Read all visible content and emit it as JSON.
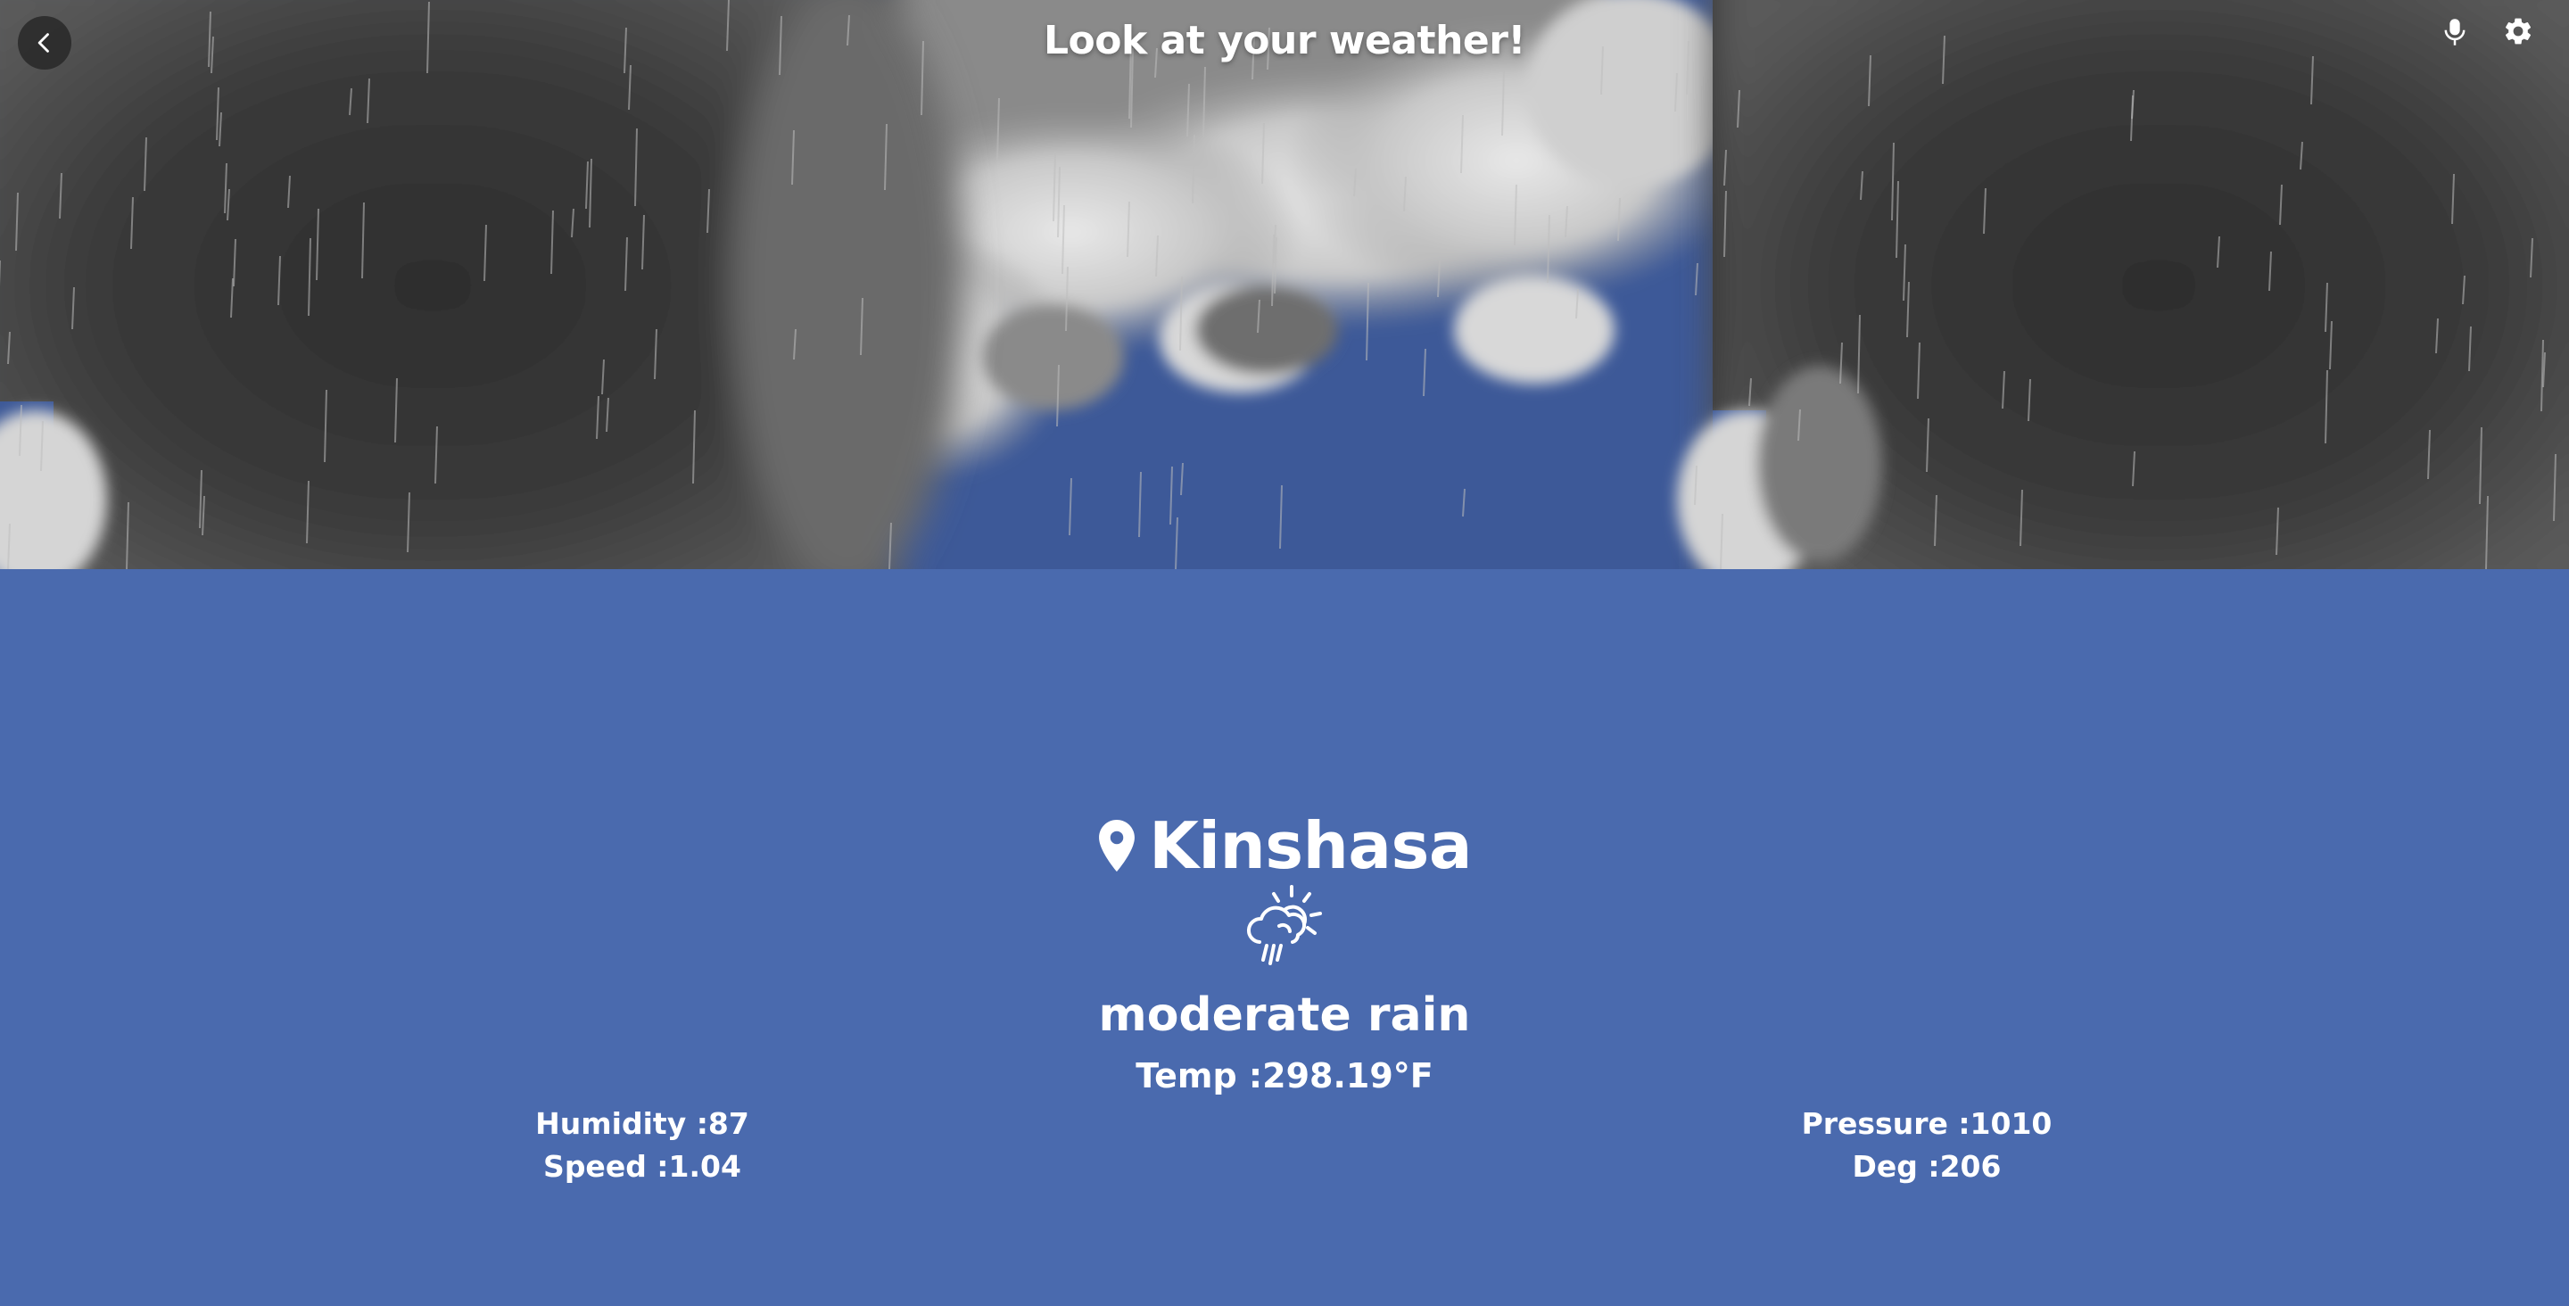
{
  "header": {
    "title": "Look at your weather!",
    "back_icon": "chevron-left-icon",
    "mic_icon": "mic-icon",
    "settings_icon": "gear-icon"
  },
  "weather": {
    "location_icon": "map-pin-icon",
    "city": "Kinshasa",
    "condition_icon": "cloud-rain-sun-icon",
    "condition": "moderate rain",
    "temp_label": "Temp :",
    "temp_value": "298.19",
    "temp_unit": "°F"
  },
  "stats": {
    "left": [
      {
        "label": "Humidity :",
        "value": "87"
      },
      {
        "label": "Speed :",
        "value": "1.04"
      }
    ],
    "right": [
      {
        "label": "Pressure :",
        "value": "1010"
      },
      {
        "label": "Deg :",
        "value": "206"
      }
    ]
  },
  "colors": {
    "background": "#4a6aae",
    "sky": "#3d5998",
    "storm_cloud": "#363636",
    "text": "#ffffff"
  }
}
